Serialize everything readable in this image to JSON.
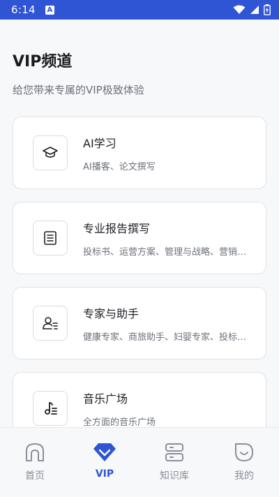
{
  "status_bar": {
    "time": "6:14",
    "notification_letter": "A"
  },
  "header": {
    "title": "VIP频道",
    "subtitle": "给您带来专属的VIP极致体验"
  },
  "cards": [
    {
      "icon": "graduation-cap-icon",
      "title": "AI学习",
      "desc": "AI播客、论文撰写"
    },
    {
      "icon": "document-list-icon",
      "title": "专业报告撰写",
      "desc": "投标书、运营方案、管理与战略、营销…"
    },
    {
      "icon": "person-expert-icon",
      "title": "专家与助手",
      "desc": "健康专家、商旅助手、妇婴专家、投标…"
    },
    {
      "icon": "music-note-icon",
      "title": "音乐广场",
      "desc": "全方面的音乐广场"
    }
  ],
  "tabs": [
    {
      "icon": "home-icon",
      "label": "首页",
      "active": false
    },
    {
      "icon": "diamond-icon",
      "label": "VIP",
      "active": true
    },
    {
      "icon": "database-icon",
      "label": "知识库",
      "active": false
    },
    {
      "icon": "smile-face-icon",
      "label": "我的",
      "active": false
    }
  ],
  "colors": {
    "accent": "#2f55d4",
    "status_bar": "#2f55d4",
    "text_muted": "#6b7079",
    "tab_inactive": "#8a8f98"
  }
}
